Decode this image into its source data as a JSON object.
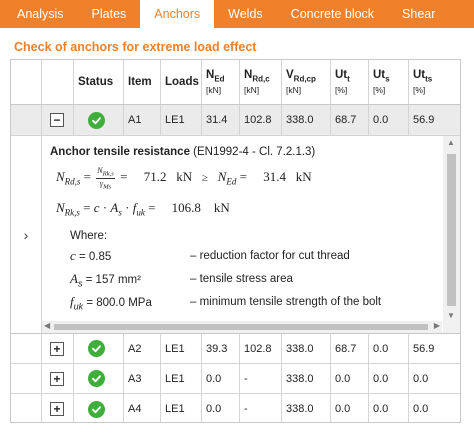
{
  "tabs": [
    {
      "label": "Analysis",
      "active": false
    },
    {
      "label": "Plates",
      "active": false
    },
    {
      "label": "Anchors",
      "active": true
    },
    {
      "label": "Welds",
      "active": false
    },
    {
      "label": "Concrete block",
      "active": false
    },
    {
      "label": "Shear",
      "active": false
    }
  ],
  "section_title": "Check of anchors for extreme load effect",
  "colors": {
    "accent": "#f0812a",
    "ok": "#3fae3a"
  },
  "table": {
    "headers": {
      "status": "Status",
      "item": "Item",
      "loads": "Loads",
      "ned": {
        "base": "N",
        "sub": "Ed",
        "unit": "[kN]"
      },
      "nrdc": {
        "base": "N",
        "sub": "Rd,c",
        "unit": "[kN]"
      },
      "vrdcp": {
        "base": "V",
        "sub": "Rd,cp",
        "unit": "[kN]"
      },
      "utt": {
        "base": "Ut",
        "sub": "t",
        "unit": "[%]"
      },
      "uts": {
        "base": "Ut",
        "sub": "s",
        "unit": "[%]"
      },
      "utts": {
        "base": "Ut",
        "sub": "ts",
        "unit": "[%]"
      }
    },
    "rows": [
      {
        "toggle": "−",
        "status_icon": "check-circle-icon",
        "item": "A1",
        "loads": "LE1",
        "ned": "31.4",
        "nrdc": "102.8",
        "vrdcp": "338.0",
        "utt": "68.7",
        "uts": "0.0",
        "utts": "56.9"
      },
      {
        "toggle": "+",
        "status_icon": "check-circle-icon",
        "item": "A2",
        "loads": "LE1",
        "ned": "39.3",
        "nrdc": "102.8",
        "vrdcp": "338.0",
        "utt": "68.7",
        "uts": "0.0",
        "utts": "56.9"
      },
      {
        "toggle": "+",
        "status_icon": "check-circle-icon",
        "item": "A3",
        "loads": "LE1",
        "ned": "0.0",
        "nrdc": "-",
        "vrdcp": "338.0",
        "utt": "0.0",
        "uts": "0.0",
        "utts": "0.0"
      },
      {
        "toggle": "+",
        "status_icon": "check-circle-icon",
        "item": "A4",
        "loads": "LE1",
        "ned": "0.0",
        "nrdc": "-",
        "vrdcp": "338.0",
        "utt": "0.0",
        "uts": "0.0",
        "utts": "0.0"
      }
    ]
  },
  "detail": {
    "heading_bold": "Anchor tensile resistance",
    "heading_ref": " (EN1992-4 - Cl. 7.2.1.3)",
    "f1": {
      "lhs": "N",
      "lhs_sub": "Rd,s",
      "num": "N",
      "num_sub": "Rk,s",
      "den": "γ",
      "den_sub": "Ms",
      "value": "71.2",
      "unit": "kN",
      "cmp": "≥",
      "rhs": "N",
      "rhs_sub": "Ed",
      "rhs_value": "31.4",
      "rhs_unit": "kN"
    },
    "f2": {
      "lhs": "N",
      "lhs_sub": "Rk,s",
      "expr_c": "c",
      "expr_a": "A",
      "expr_a_sub": "s",
      "expr_f": "f",
      "expr_f_sub": "uk",
      "value": "106.8",
      "unit": "kN"
    },
    "where_label": "Where:",
    "vars": [
      {
        "sym": "c",
        "sub": "",
        "val": " = 0.85",
        "desc": "– reduction factor for cut thread"
      },
      {
        "sym": "A",
        "sub": "s",
        "val": " = 157 mm²",
        "desc": "– tensile stress area"
      },
      {
        "sym": "f",
        "sub": "uk",
        "val": " = 800.0 MPa",
        "desc": "– minimum tensile strength of the bolt"
      }
    ],
    "expand_icon": "chevron-right-icon"
  }
}
